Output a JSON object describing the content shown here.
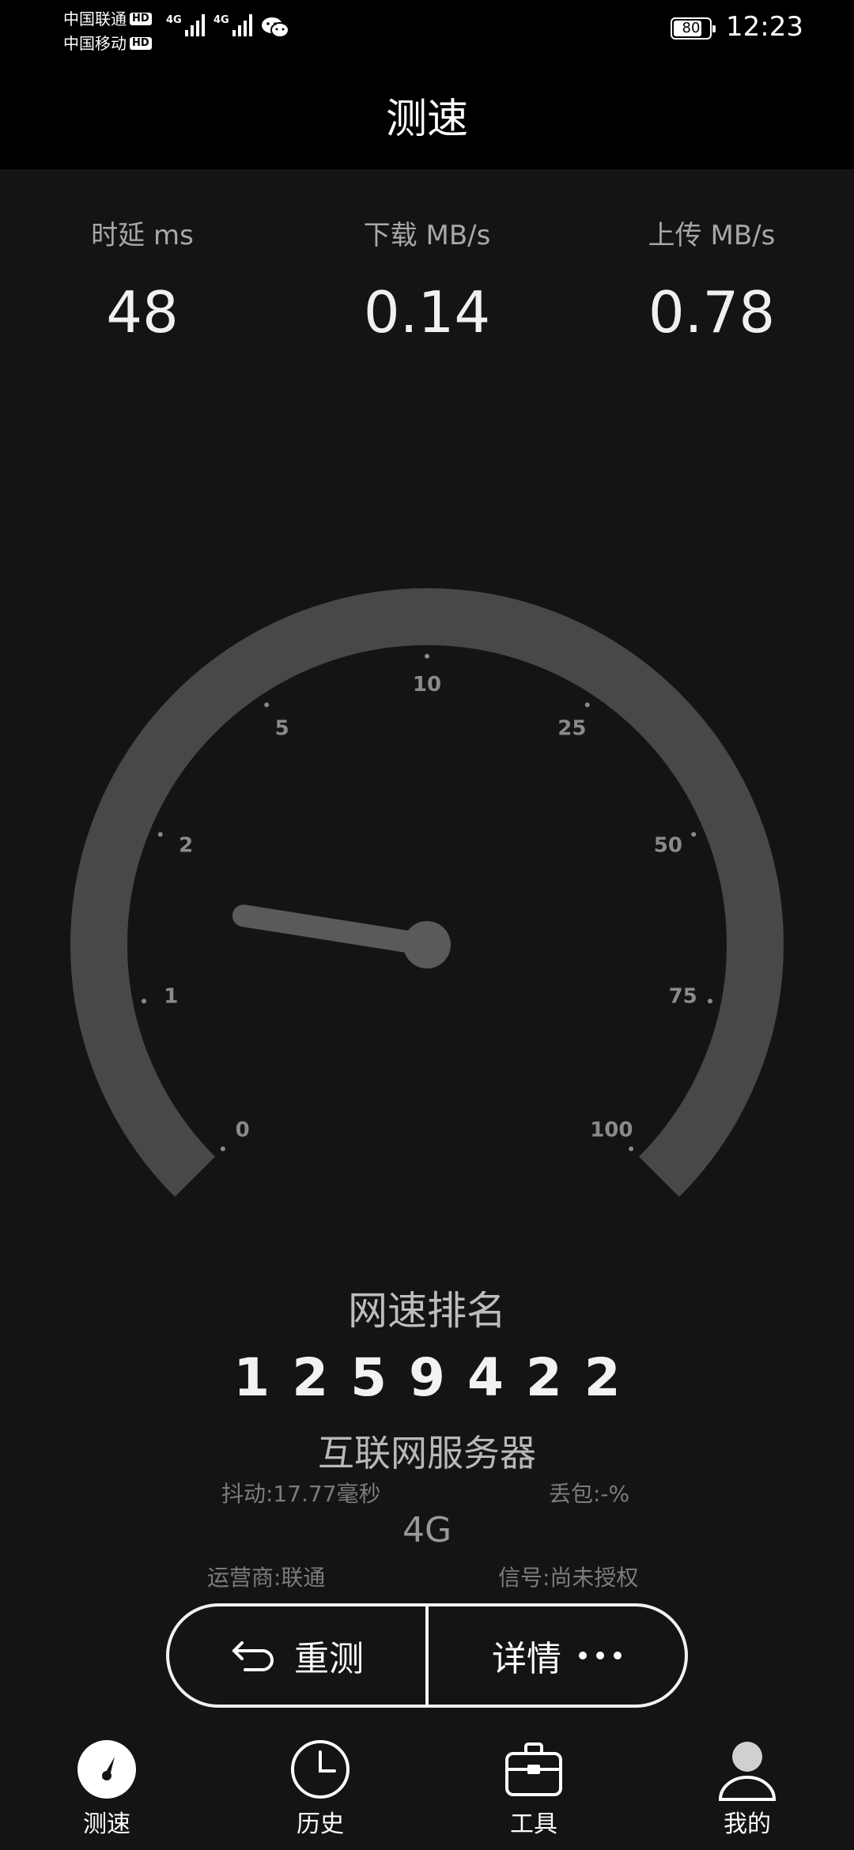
{
  "status_bar": {
    "carrier_1": "中国联通",
    "carrier_2": "中国移动",
    "hd_badge": "HD",
    "network_type_1": "4G",
    "network_type_2": "4G",
    "battery_level": "80",
    "battery_fraction": 0.8,
    "time": "12:23"
  },
  "header": {
    "title": "测速"
  },
  "metrics": [
    {
      "label": "时延 ms",
      "value": "48"
    },
    {
      "label": "下载 MB/s",
      "value": "0.14"
    },
    {
      "label": "上传 MB/s",
      "value": "0.78"
    }
  ],
  "gauge": {
    "tick_labels": [
      "0",
      "1",
      "2",
      "5",
      "10",
      "25",
      "50",
      "75",
      "100"
    ],
    "needle_value": 1.6,
    "colors": {
      "track": "#484848",
      "needle": "#5a5a5a",
      "tick_text": "#8a8a8a"
    }
  },
  "ranking": {
    "title": "网速排名",
    "number": "1259422"
  },
  "server": {
    "name": "互联网服务器",
    "jitter": "抖动:17.77毫秒",
    "packet_loss": "丢包:-%",
    "network_generation": "4G",
    "operator": "运营商:联通",
    "signal": "信号:尚未授权"
  },
  "actions": {
    "retest_label": "重测",
    "details_label": "详情"
  },
  "tabs": [
    {
      "label": "测速",
      "icon": "speedometer-icon",
      "active": true
    },
    {
      "label": "历史",
      "icon": "clock-icon",
      "active": false
    },
    {
      "label": "工具",
      "icon": "toolbox-icon",
      "active": false
    },
    {
      "label": "我的",
      "icon": "person-icon",
      "active": false
    }
  ]
}
